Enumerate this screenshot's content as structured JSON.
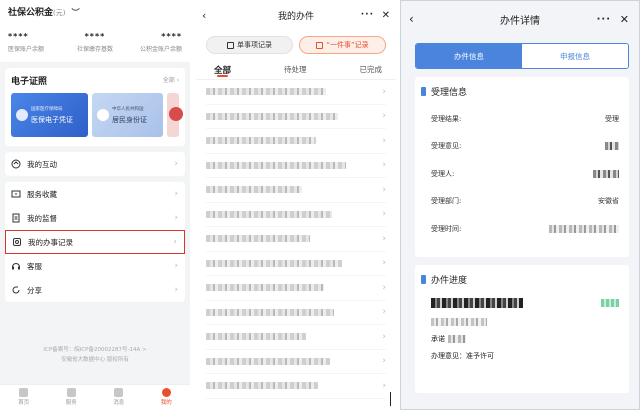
{
  "pane1": {
    "title": "社保公积金",
    "unit": "(元)",
    "eye": "︶",
    "stats": [
      {
        "value": "****",
        "label": "医保账户余额"
      },
      {
        "value": "****",
        "label": "社保缴存基数"
      },
      {
        "value": "****",
        "label": "公积金账户余额"
      }
    ],
    "certs": {
      "title": "电子证照",
      "more": "全部 ›",
      "card_a": {
        "sub": "国家医疗保障局",
        "main": "医保电子凭证"
      },
      "card_b": {
        "sub": "中华人民共和国",
        "main": "居民身份证"
      }
    },
    "items": [
      {
        "label": "我的互动",
        "icon": "interaction-icon"
      },
      {
        "label": "服务收藏",
        "icon": "favorite-icon"
      },
      {
        "label": "我的监督",
        "icon": "supervision-icon"
      },
      {
        "label": "我的办事记录",
        "icon": "record-icon"
      },
      {
        "label": "客服",
        "icon": "headset-icon"
      },
      {
        "label": "分享",
        "icon": "share-icon"
      }
    ],
    "footer": [
      "ICP备案号：皖ICP备20002287号-14A >",
      "安徽省大数据中心 版权所有"
    ],
    "tabs": [
      "首页",
      "服务",
      "消息",
      "我的"
    ]
  },
  "pane2": {
    "title": "我的办件",
    "seg": [
      "单事项记录",
      "“一件事”记录"
    ],
    "tabs": [
      "全部",
      "待处理",
      "已完成"
    ]
  },
  "pane3": {
    "title": "办件详情",
    "seg": [
      "办件信息",
      "申报信息"
    ],
    "accept_title": "受理信息",
    "rows": [
      {
        "key": "受理结果:",
        "value": "受理"
      },
      {
        "key": "受理意见:",
        "value": ""
      },
      {
        "key": "受理人:",
        "value": ""
      },
      {
        "key": "受理部门:",
        "value": "安徽省"
      },
      {
        "key": "受理时间:",
        "value": ""
      }
    ],
    "progress_title": "办件进度",
    "progress_lines": {
      "line2": "承诺",
      "line3": "办理意见：准予许可"
    }
  },
  "colors": {
    "accent": "#e8502d",
    "blue": "#4b84dd",
    "highlight": "#d9342b"
  }
}
